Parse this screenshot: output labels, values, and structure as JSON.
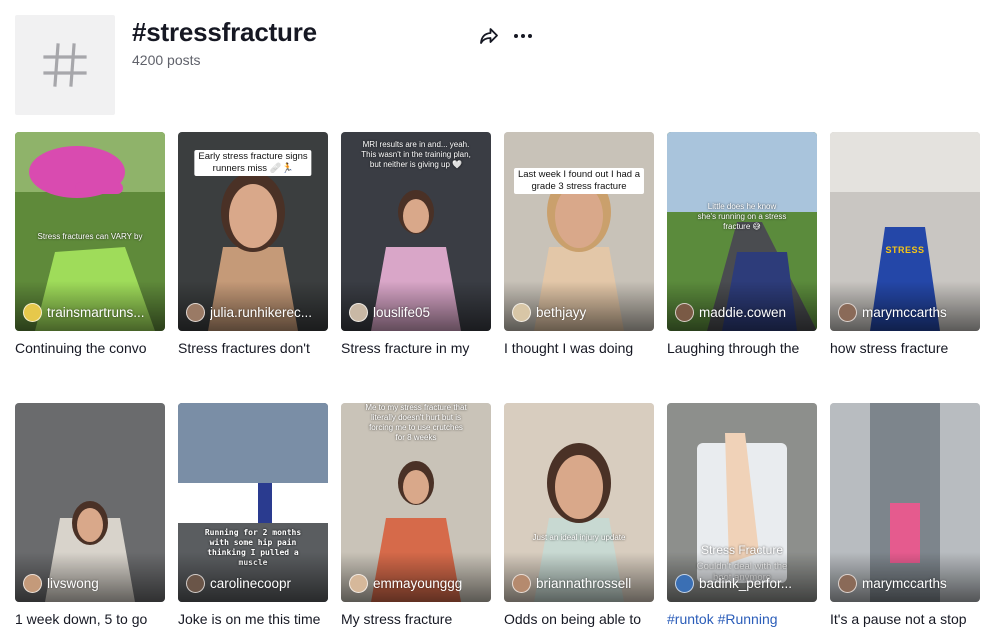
{
  "header": {
    "title": "#stressfracture",
    "posts_count": "4200 posts",
    "icons": {
      "tag": "hashtag-icon",
      "share": "share-icon",
      "more": "more-icon"
    }
  },
  "videos": [
    {
      "username": "trainsmartruns...",
      "caption": "Continuing the convo",
      "overlay": "Stress fractures can VARY by",
      "colors": {
        "bg": "#5f8a3a",
        "accent": "#d94bb0",
        "avatar": "#e6c84b"
      }
    },
    {
      "username": "julia.runhikerec...",
      "caption": "Stress fractures don't",
      "overlay": "Early stress fracture signs\nrunners miss 🩹🏃",
      "colors": {
        "bg": "#3b3e3f",
        "accent": "#c59a78",
        "avatar": "#9a7a65"
      }
    },
    {
      "username": "louslife05",
      "caption": "Stress fracture in my",
      "overlay": "MRI results are in and... yeah.\nThis wasn't in the training plan,\nbut neither is giving up 🤍",
      "colors": {
        "bg": "#3a3d44",
        "accent": "#d9a6c8",
        "avatar": "#c9b8a5"
      }
    },
    {
      "username": "bethjayy",
      "caption": "I thought I was doing",
      "overlay": "Last week I found out I had a\ngrade 3 stress fracture",
      "colors": {
        "bg": "#c8c2b8",
        "accent": "#e3c7a8",
        "avatar": "#d8c6a6"
      }
    },
    {
      "username": "maddie.cowen",
      "caption": "Laughing through the",
      "overlay": "Little does he know\nshe's running on a stress\nfracture 😅",
      "colors": {
        "bg": "#5b8b3c",
        "accent": "#2d3c7a",
        "avatar": "#7a5a45"
      }
    },
    {
      "username": "marymccarths",
      "caption": "how stress fracture",
      "overlay": "STRESS",
      "colors": {
        "bg": "#c9c6c2",
        "accent": "#2447a8",
        "avatar": "#8a6a58"
      }
    },
    {
      "username": "livswong",
      "caption": "1 week down, 5 to go",
      "overlay": "",
      "colors": {
        "bg": "#6a6b6d",
        "accent": "#d8d3cb",
        "avatar": "#c49a7a"
      }
    },
    {
      "username": "carolinecoopr",
      "caption": "Joke is on me this time",
      "overlay": "Running for 2 months\nwith some hip pain\nthinking I pulled a\nmuscle",
      "colors": {
        "bg": "#4d5d70",
        "accent": "#2a3b8f",
        "avatar": "#6a5548"
      }
    },
    {
      "username": "emmayounggg",
      "caption": "My stress fracture",
      "overlay": "Me to my stress fracture that\nliterally doesn't hurt but is\nforcing me to use crutches\nfor 8 weeks",
      "colors": {
        "bg": "#c9c3b8",
        "accent": "#d66a4a",
        "avatar": "#d6b89a"
      }
    },
    {
      "username": "briannathrossell",
      "caption": "Odds on being able to",
      "overlay": "Just an ideal injury update",
      "colors": {
        "bg": "#d8cdbf",
        "accent": "#c8d9d2",
        "avatar": "#b58a6e"
      }
    },
    {
      "username": "badink_perfor...",
      "caption": "#runtok #Running",
      "overlay": "Stress Fracture",
      "overlay_sub": "Couldn't deal with the\nboot anymore",
      "colors": {
        "bg": "#8d8f8c",
        "accent": "#f0d2b8",
        "avatar": "#3a6fb4"
      }
    },
    {
      "username": "marymccarths",
      "caption": "It's a pause not a stop",
      "overlay": "",
      "colors": {
        "bg": "#b8bcc0",
        "accent": "#e55b8e",
        "avatar": "#8a6a58"
      }
    }
  ]
}
